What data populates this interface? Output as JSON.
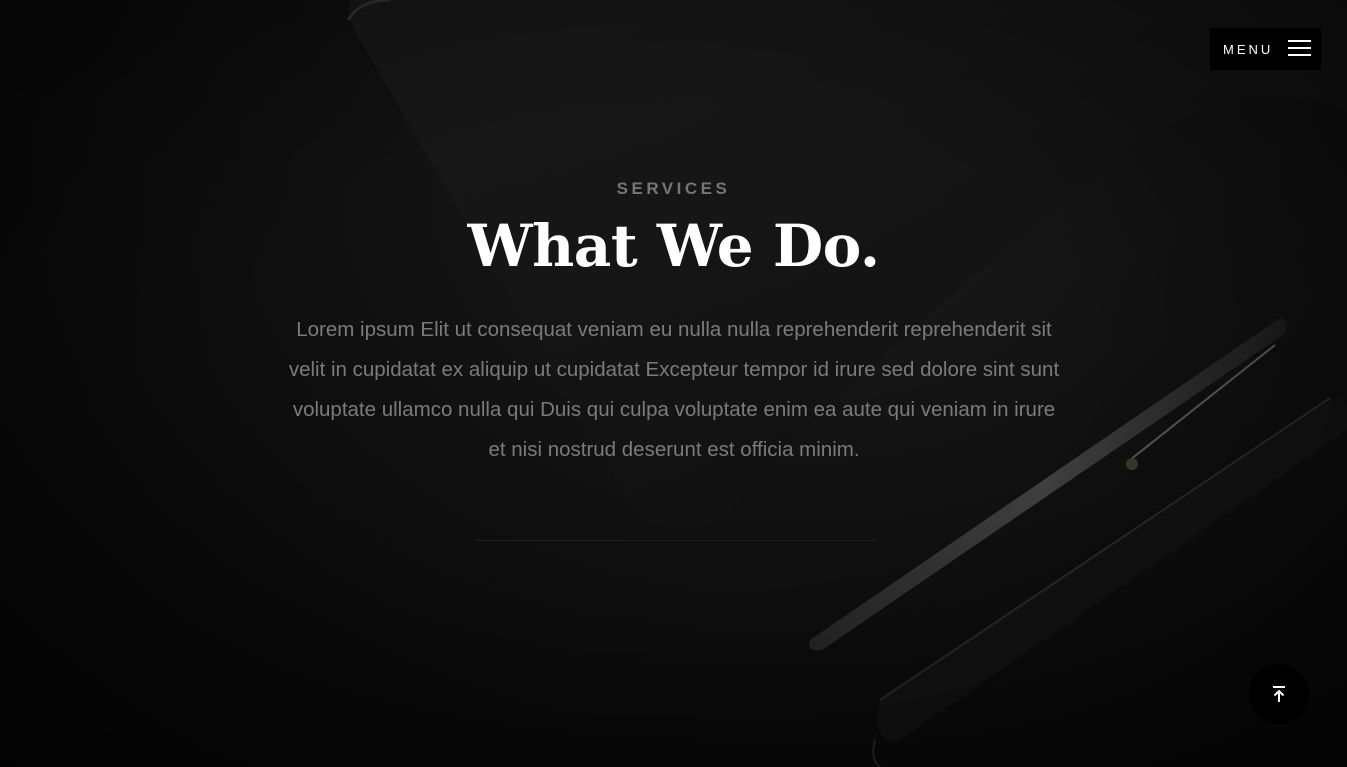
{
  "header": {
    "menu_label": "MENU",
    "menu_icon": "hamburger-icon"
  },
  "hero": {
    "eyebrow": "SERVICES",
    "title": "What We Do.",
    "description": "Lorem ipsum Elit ut consequat veniam eu nulla nulla reprehenderit reprehenderit sit velit in cupidatat ex aliquip ut cupidatat Excepteur tempor id irure sed dolore sint sunt voluptate ullamco nulla qui Duis qui culpa voluptate enim ea aute qui veniam in irure et nisi nostrud deserunt est officia minim."
  },
  "back_to_top": {
    "icon": "arrow-up-to-line-icon"
  },
  "colors": {
    "background": "#0b0b0b",
    "eyebrow": "#757575",
    "title": "#ffffff",
    "body_text": "#7b7b7b",
    "button_bg": "#000000"
  }
}
